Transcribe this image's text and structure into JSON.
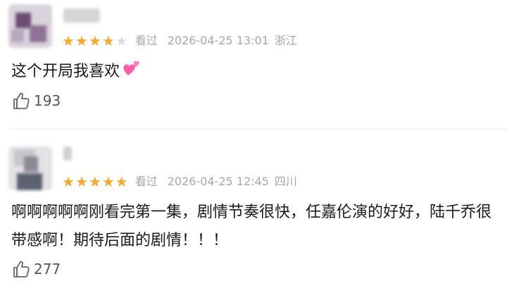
{
  "comments": [
    {
      "rating": 4,
      "max_rating": 5,
      "watched_label": "看过",
      "date": "2026-04-25 13:01",
      "location": "浙江",
      "text": "这个开局我喜欢",
      "emoji": "heart-icon",
      "likes": "193"
    },
    {
      "rating": 5,
      "max_rating": 5,
      "watched_label": "看过",
      "date": "2026-04-25 12:45",
      "location": "四川",
      "text": "啊啊啊啊啊刚看完第一集，剧情节奏很快，任嘉伦演的好好，陆千乔很带感啊！期待后面的剧情！！！",
      "likes": "277"
    }
  ],
  "colors": {
    "star_on": "#f7a928",
    "star_off": "#dcdcdc",
    "meta": "#a8a8a8",
    "text": "#1a1a1a"
  }
}
